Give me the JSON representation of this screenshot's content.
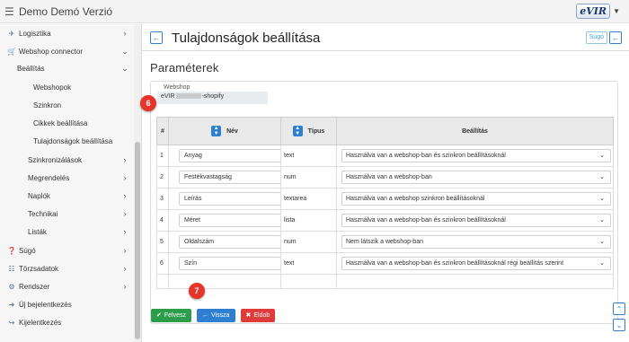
{
  "topbar": {
    "title": "Demo Demó Verzió",
    "brand": "eVIR",
    "menu_icon": "hamburger-icon"
  },
  "sidebar": {
    "items": [
      {
        "label": "Logisztika",
        "icon": "truck-icon",
        "chevron": "›"
      },
      {
        "label": "Webshop connector",
        "icon": "cart-icon",
        "chevron": "⌄"
      },
      {
        "label": "Beállítás",
        "icon": "",
        "chevron": "⌄"
      },
      {
        "label": "Webshopok",
        "icon": "",
        "chevron": ""
      },
      {
        "label": "Szinkron",
        "icon": "",
        "chevron": ""
      },
      {
        "label": "Cikkek beállítása",
        "icon": "",
        "chevron": ""
      },
      {
        "label": "Tulajdonságok beállítása",
        "icon": "",
        "chevron": ""
      },
      {
        "label": "Szinkronizálások",
        "icon": "",
        "chevron": "›"
      },
      {
        "label": "Megrendelés",
        "icon": "",
        "chevron": "›"
      },
      {
        "label": "Naplók",
        "icon": "",
        "chevron": "›"
      },
      {
        "label": "Technikai",
        "icon": "",
        "chevron": "›"
      },
      {
        "label": "Listák",
        "icon": "",
        "chevron": "›"
      },
      {
        "label": "Súgó",
        "icon": "question-icon",
        "chevron": "›"
      },
      {
        "label": "Törzsadatok",
        "icon": "database-icon",
        "chevron": "›"
      },
      {
        "label": "Rendszer",
        "icon": "gears-icon",
        "chevron": "›"
      },
      {
        "label": "Új bejelentkezés",
        "icon": "sign-in-icon",
        "chevron": ""
      },
      {
        "label": "Kijelentkezés",
        "icon": "sign-out-icon",
        "chevron": ""
      }
    ]
  },
  "header": {
    "title": "Tulajdonságok beállítása",
    "help": "Súgó"
  },
  "section": {
    "title": "Paraméterek"
  },
  "webshop": {
    "label": "Webshop",
    "value_prefix": "eVIR",
    "value_suffix": "-shopify"
  },
  "table": {
    "headers": {
      "index": "#",
      "name": "Név",
      "type": "Típus",
      "setting": "Beállítás"
    },
    "rows": [
      {
        "index": "1",
        "name": "Anyag",
        "type": "text",
        "setting": "Használva van a webshop-ban és szinkron beállításoknál"
      },
      {
        "index": "2",
        "name": "Festékvastagság",
        "type": "num",
        "setting": "Használva van a webshop-ban"
      },
      {
        "index": "3",
        "name": "Leírás",
        "type": "textarea",
        "setting": "Használva van a webshop szinkron beállításoknál"
      },
      {
        "index": "4",
        "name": "Méret",
        "type": "lista",
        "setting": "Használva van a webshop-ban és szinkron beállításoknál"
      },
      {
        "index": "5",
        "name": "Oldalszám",
        "type": "num",
        "setting": "Nem látszik a webshop-ban"
      },
      {
        "index": "6",
        "name": "Szín",
        "type": "text",
        "setting": "Használva van a webshop-ban és szinkron beállításoknál régi beállítás szerint"
      }
    ]
  },
  "buttons": {
    "save": "Felvesz",
    "back": "Vissza",
    "discard": "Eldob"
  },
  "badges": {
    "b6": "6",
    "b7": "7"
  },
  "colors": {
    "primary": "#2f7fd1",
    "success": "#2e9d4b",
    "danger": "#e03b3b",
    "badge": "#e8352b"
  }
}
